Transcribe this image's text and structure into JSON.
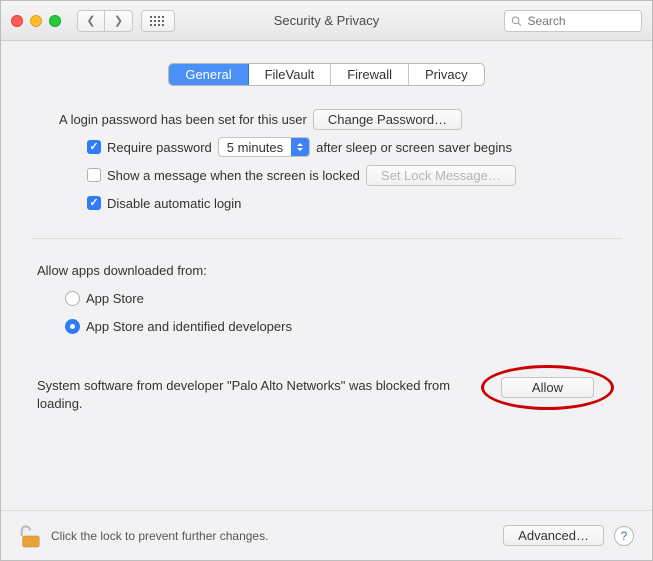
{
  "window": {
    "title": "Security & Privacy",
    "search_placeholder": "Search"
  },
  "tabs": {
    "general": "General",
    "filevault": "FileVault",
    "firewall": "Firewall",
    "privacy": "Privacy"
  },
  "login": {
    "heading": "A login password has been set for this user",
    "change_password": "Change Password…",
    "require_password_pre": "Require password",
    "require_password_delay": "5 minutes",
    "require_password_post": "after sleep or screen saver begins",
    "show_message": "Show a message when the screen is locked",
    "set_lock_message": "Set Lock Message…",
    "disable_auto_login": "Disable automatic login",
    "require_password_checked": true,
    "show_message_checked": false,
    "disable_auto_login_checked": true
  },
  "downloads": {
    "heading": "Allow apps downloaded from:",
    "app_store": "App Store",
    "app_store_identified": "App Store and identified developers",
    "selected": "app_store_identified"
  },
  "blocked": {
    "message": "System software from developer \"Palo Alto Networks\" was blocked from loading.",
    "allow": "Allow"
  },
  "footer": {
    "lock_text": "Click the lock to prevent further changes.",
    "advanced": "Advanced…",
    "help": "?"
  },
  "icons": {
    "back": "chevron-left-icon",
    "forward": "chevron-right-icon",
    "show_all": "grid-icon",
    "search": "search-icon",
    "lock": "lock-open-icon",
    "help": "help-icon"
  }
}
